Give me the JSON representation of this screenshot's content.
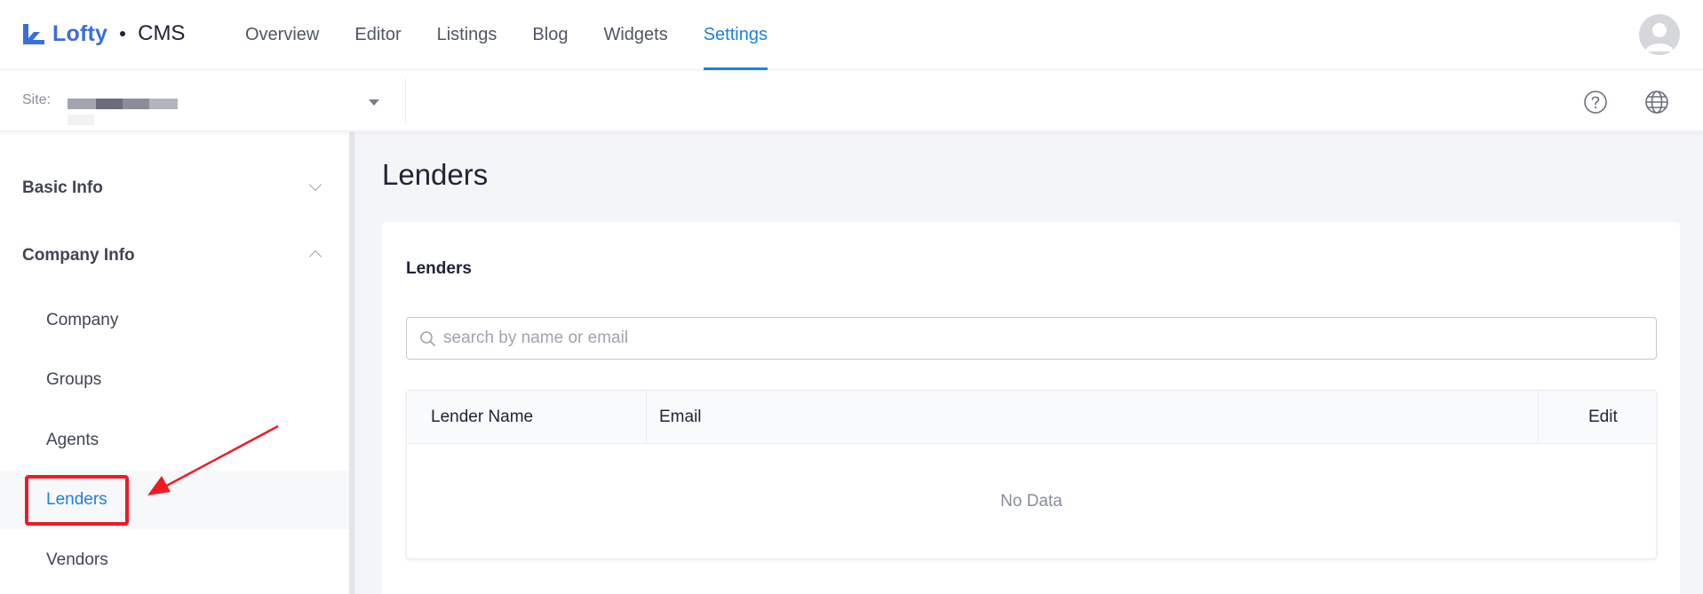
{
  "header": {
    "brand": "Lofty",
    "product": "CMS",
    "nav": [
      {
        "label": "Overview",
        "active": false
      },
      {
        "label": "Editor",
        "active": false
      },
      {
        "label": "Listings",
        "active": false
      },
      {
        "label": "Blog",
        "active": false
      },
      {
        "label": "Widgets",
        "active": false
      },
      {
        "label": "Settings",
        "active": true
      }
    ],
    "accent_color": "#1f7ee5"
  },
  "sitebar": {
    "site_label": "Site:",
    "icons": [
      "help-icon",
      "globe-icon"
    ]
  },
  "sidebar": {
    "groups": [
      {
        "label": "Basic Info",
        "expanded": false
      },
      {
        "label": "Company Info",
        "expanded": true
      }
    ],
    "items": [
      {
        "label": "Company",
        "active": false
      },
      {
        "label": "Groups",
        "active": false
      },
      {
        "label": "Agents",
        "active": false
      },
      {
        "label": "Lenders",
        "active": true
      },
      {
        "label": "Vendors",
        "active": false
      }
    ]
  },
  "main": {
    "page_title": "Lenders",
    "card_title": "Lenders",
    "search_placeholder": "search by name or email",
    "table": {
      "columns": [
        "Lender Name",
        "Email",
        "Edit"
      ],
      "rows": [],
      "empty_text": "No Data"
    }
  },
  "annotation_color": "#ee1b24"
}
